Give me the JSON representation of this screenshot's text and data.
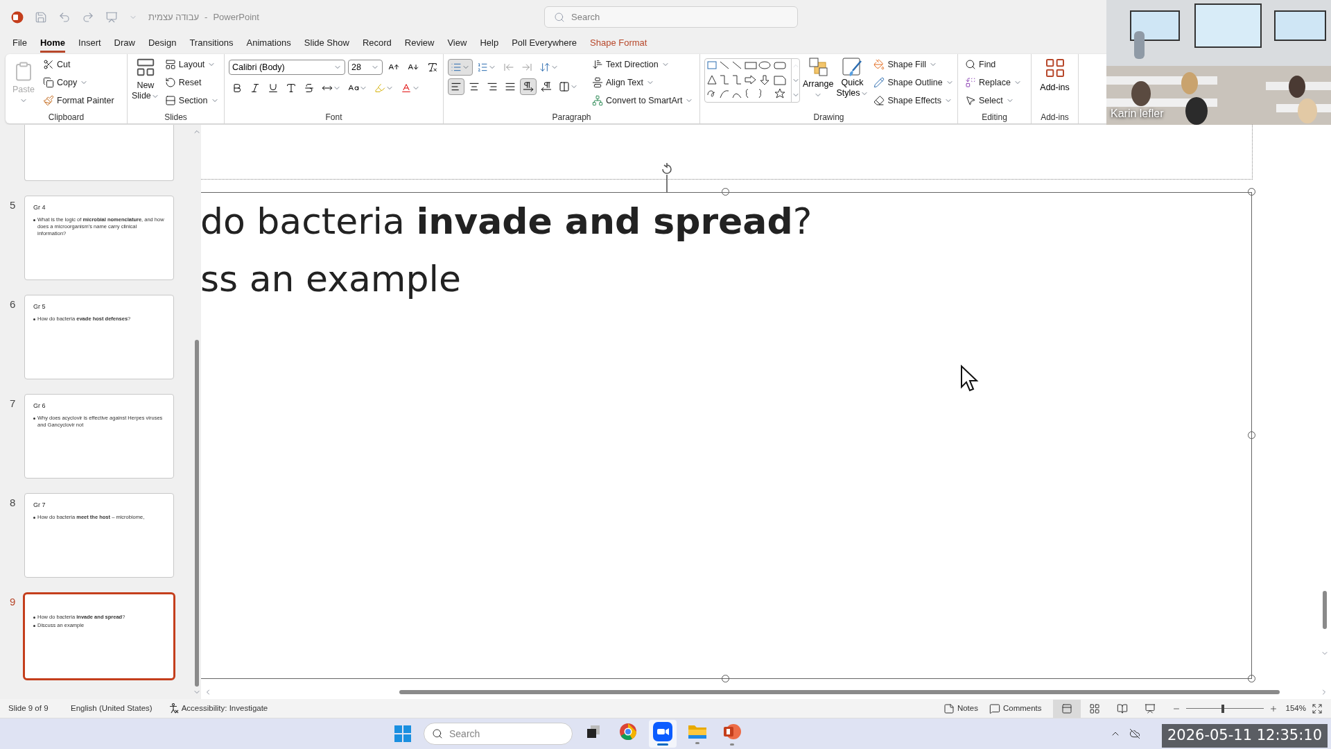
{
  "title_bar": {
    "document": "עבודה עצמית",
    "separator": "-",
    "app": "PowerPoint",
    "search_placeholder": "Search"
  },
  "tabs": [
    {
      "label": "File",
      "selected": false,
      "kind": "standard"
    },
    {
      "label": "Home",
      "selected": true,
      "kind": "standard"
    },
    {
      "label": "Insert",
      "selected": false,
      "kind": "standard"
    },
    {
      "label": "Draw",
      "selected": false,
      "kind": "standard"
    },
    {
      "label": "Design",
      "selected": false,
      "kind": "standard"
    },
    {
      "label": "Transitions",
      "selected": false,
      "kind": "standard"
    },
    {
      "label": "Animations",
      "selected": false,
      "kind": "standard"
    },
    {
      "label": "Slide Show",
      "selected": false,
      "kind": "standard"
    },
    {
      "label": "Record",
      "selected": false,
      "kind": "standard"
    },
    {
      "label": "Review",
      "selected": false,
      "kind": "standard"
    },
    {
      "label": "View",
      "selected": false,
      "kind": "standard"
    },
    {
      "label": "Help",
      "selected": false,
      "kind": "standard"
    },
    {
      "label": "Poll Everywhere",
      "selected": false,
      "kind": "standard"
    },
    {
      "label": "Shape Format",
      "selected": false,
      "kind": "contextual"
    }
  ],
  "ribbon": {
    "clipboard": {
      "label": "Clipboard",
      "paste": {
        "label": "Paste",
        "disabled": true
      },
      "cut": "Cut",
      "copy": "Copy",
      "format_painter": "Format Painter"
    },
    "slides": {
      "label": "Slides",
      "new_slide": [
        "New",
        "Slide"
      ],
      "layout": "Layout",
      "reset": "Reset",
      "section": "Section"
    },
    "font": {
      "label": "Font",
      "font_name": "Calibri (Body)",
      "font_size": "28"
    },
    "paragraph": {
      "label": "Paragraph",
      "bullets": {
        "selected": true
      },
      "alignments": [
        {
          "kind": "left",
          "selected": true
        },
        {
          "kind": "center",
          "selected": false
        },
        {
          "kind": "right",
          "selected": false
        },
        {
          "kind": "justify",
          "selected": false
        }
      ],
      "directions": [
        {
          "kind": "ltr",
          "selected": true
        },
        {
          "kind": "rtl",
          "selected": false
        }
      ],
      "text_direction": "Text Direction",
      "align_text": "Align Text",
      "smartart": "Convert to SmartArt"
    },
    "drawing": {
      "label": "Drawing",
      "arrange": "Arrange",
      "quick_styles": [
        "Quick",
        "Styles"
      ],
      "shape_fill": "Shape Fill",
      "shape_outline": "Shape Outline",
      "shape_effects": "Shape Effects"
    },
    "editing": {
      "label": "Editing",
      "find": "Find",
      "replace": "Replace",
      "select": "Select"
    },
    "addins": {
      "label": "Add-ins",
      "button": "Add-ins"
    }
  },
  "video": {
    "participant": "Karin lefler"
  },
  "slides": [
    {
      "selected": false
    },
    {
      "number": "5",
      "title": "Gr 4",
      "lines": [
        "What is the logic of **microbial nomenclature**, and how does a microorganism's name carry clinical information?"
      ],
      "selected": false
    },
    {
      "number": "6",
      "title": "Gr 5",
      "lines": [
        "How do bacteria **evade host defenses**?"
      ],
      "selected": false
    },
    {
      "number": "7",
      "title": "Gr 6",
      "lines": [
        "Why does acyclovir is effective against Herpes viruses and Gancyclovir not"
      ],
      "selected": false
    },
    {
      "number": "8",
      "title": "Gr 7",
      "lines": [
        "How do bacteria **meet the host** – microbiome,"
      ],
      "selected": false
    },
    {
      "number": "9",
      "lines": [
        "How do bacteria **invade and spread**?",
        "Discuss an example"
      ],
      "selected": true
    }
  ],
  "slide": {
    "lines": [
      "do bacteria **invade and spread**?",
      "ss an example"
    ]
  },
  "status_bar": {
    "slide_count": "Slide 9 of 9",
    "language": "English (United States)",
    "accessibility": "Accessibility: Investigate",
    "notes": "Notes",
    "comments": "Comments",
    "views": [
      {
        "kind": "normal",
        "selected": true
      },
      {
        "kind": "sorter",
        "selected": false
      },
      {
        "kind": "reading",
        "selected": false
      },
      {
        "kind": "slideshow",
        "selected": false
      }
    ],
    "zoom": {
      "level": 0.48,
      "reading": "154%"
    }
  },
  "taskbar": {
    "search_placeholder": "Search",
    "apps": [
      {
        "kind": "taskview",
        "running": false,
        "active": false
      },
      {
        "kind": "chrome",
        "running": false,
        "active": false
      },
      {
        "kind": "zoom",
        "running": true,
        "active": true
      },
      {
        "kind": "files",
        "running": true,
        "active": false
      },
      {
        "kind": "powerpoint",
        "running": true,
        "active": false
      }
    ]
  },
  "timestamp": "2026-05-11 12:35:10"
}
